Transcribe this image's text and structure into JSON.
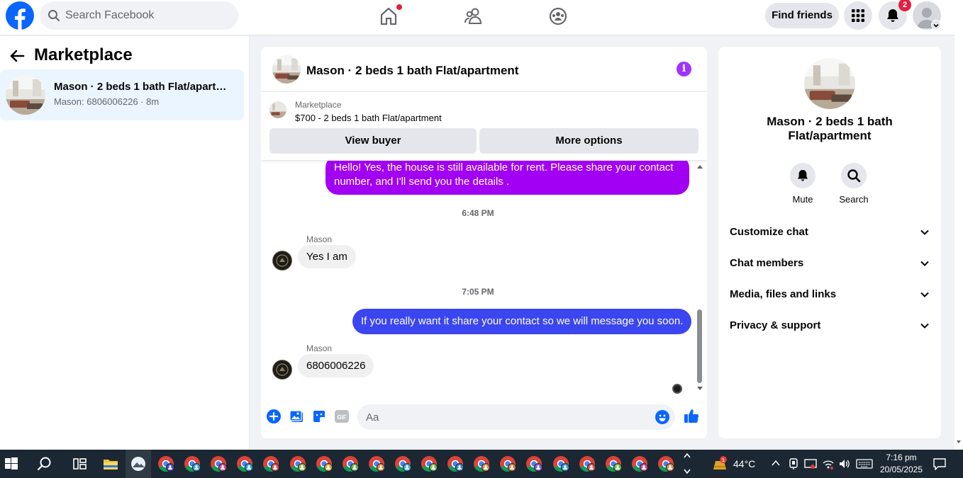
{
  "header": {
    "search_placeholder": "Search Facebook",
    "find_friends_label": "Find friends",
    "notification_count": "2",
    "brand_color": "#0866ff"
  },
  "sidebar": {
    "title": "Marketplace",
    "conversations": [
      {
        "title": "Mason · 2 beds 1 bath Flat/apartm...",
        "subtitle": "Mason: 6806006226 · 8m"
      }
    ]
  },
  "chat": {
    "title": "Mason · 2 beds 1 bath Flat/apartment",
    "listing": {
      "label": "Marketplace",
      "price_title": "$700 - 2 beds 1 bath Flat/apartment",
      "view_buyer_label": "View buyer",
      "more_options_label": "More options"
    },
    "messages": [
      {
        "type": "outgoing",
        "text": "Hello! Yes, the house is still available for rent. Please share your contact number, and I'll send you the details .",
        "color": "#a100f2"
      },
      {
        "type": "timestamp",
        "text": "6:48 PM"
      },
      {
        "type": "incoming",
        "sender": "Mason",
        "text": "Yes I am"
      },
      {
        "type": "timestamp",
        "text": "7:05 PM"
      },
      {
        "type": "outgoing",
        "text": "If you really want it share your contact so we will message you soon.",
        "color": "#3b46f0"
      },
      {
        "type": "incoming",
        "sender": "Mason",
        "text": "6806006226"
      }
    ],
    "composer_placeholder": "Aa"
  },
  "details": {
    "title": "Mason · 2 beds 1 bath Flat/apartment",
    "actions": [
      {
        "label": "Mute",
        "icon": "bell-icon"
      },
      {
        "label": "Search",
        "icon": "search-icon"
      }
    ],
    "sections": [
      "Customize chat",
      "Chat members",
      "Media, files and links",
      "Privacy & support"
    ]
  },
  "taskbar": {
    "weather": "44°C",
    "time": "7:16 pm",
    "date": "20/05/2025"
  }
}
